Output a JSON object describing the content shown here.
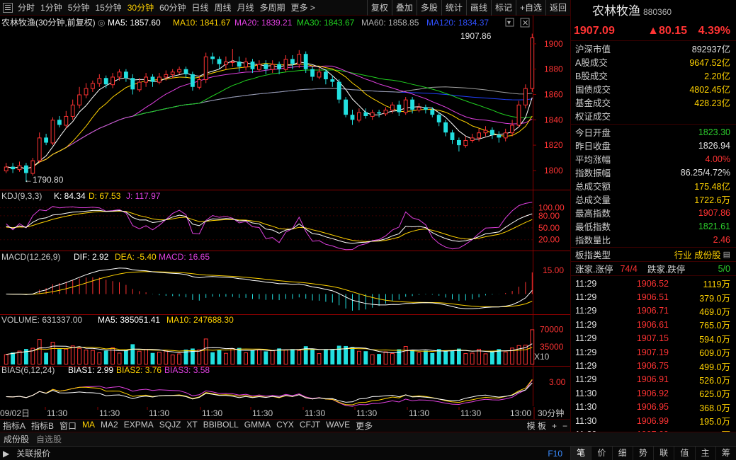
{
  "toolbar": {
    "periods": [
      "分时",
      "1分钟",
      "5分钟",
      "15分钟",
      "30分钟",
      "60分钟",
      "日线",
      "周线",
      "月线",
      "多周期",
      "更多 >"
    ],
    "active_period": "30分钟",
    "tools": [
      "复权",
      "叠加",
      "多股",
      "统计",
      "画线",
      "标记",
      "+自选",
      "返回"
    ]
  },
  "legend_main": {
    "title": "农林牧渔(30分钟,前复权)",
    "ma5": "MA5: 1857.60",
    "ma10": "MA10: 1841.67",
    "ma20": "MA20: 1839.21",
    "ma30": "MA30: 1843.67",
    "ma60": "MA60: 1858.85",
    "ma120": "MA120: 1834.37"
  },
  "legend_kdj": {
    "name": "KDJ(9,3,3)",
    "k": "K: 84.34",
    "d": "D: 67.53",
    "j": "J: 117.97"
  },
  "legend_macd": {
    "name": "MACD(12,26,9)",
    "dif": "DIF: 2.92",
    "dea": "DEA: -5.40",
    "macd": "MACD: 16.65"
  },
  "legend_vol": {
    "name": "VOLUME: 631337.00",
    "ma5": "MA5: 385051.41",
    "ma10": "MA10: 247688.30"
  },
  "legend_bias": {
    "name": "BIAS(6,12,24)",
    "b1": "BIAS1: 2.99",
    "b2": "BIAS2: 3.76",
    "b3": "BIAS3: 3.58"
  },
  "axis": {
    "price_ticks": [
      "1900",
      "1880",
      "1860",
      "1840",
      "1820",
      "1800"
    ],
    "kdj_ticks": [
      "100.00",
      "80.00",
      "50.00",
      "20.00"
    ],
    "macd_tick": "15.00",
    "vol_ticks": [
      "70000",
      "35000"
    ],
    "vol_unit": "X10",
    "bias_tick": "3.00",
    "high_label": "1907.86",
    "low_label": "←1790.80",
    "time_labels": [
      "09/02日",
      "11:30",
      "11:30",
      "11:30",
      "11:30",
      "11:30",
      "11:30",
      "11:30",
      "11:30",
      "11:30",
      "13:00"
    ],
    "period_label": "30分钟"
  },
  "indicators": [
    "指标A",
    "指标B",
    "窗口",
    "MA",
    "MA2",
    "EXPMA",
    "SQJZ",
    "XT",
    "BBIBOLL",
    "GMMA",
    "CYX",
    "CFJT",
    "WAVE",
    "更多"
  ],
  "active_indicator": "MA",
  "template_label": "模 板",
  "tabs_bottom": [
    "成份股",
    "自选股"
  ],
  "tabs_bottom2": [
    "关联报价"
  ],
  "f10": "F10",
  "side_tabs": [
    "笔",
    "价",
    "细",
    "势",
    "联",
    "值",
    "主",
    "筹"
  ],
  "panel": {
    "name": "农林牧渔",
    "code": "880360",
    "price": "1907.09",
    "change": "▲80.15",
    "pct": "4.39%",
    "stats1": [
      {
        "k": "沪深市值",
        "v": "892937亿",
        "c": "white"
      },
      {
        "k": "A股成交",
        "v": "9647.52亿",
        "c": "yellow"
      },
      {
        "k": "B股成交",
        "v": "2.20亿",
        "c": "yellow"
      },
      {
        "k": "国债成交",
        "v": "4802.45亿",
        "c": "yellow"
      },
      {
        "k": "基金成交",
        "v": "428.23亿",
        "c": "yellow"
      },
      {
        "k": "权证成交",
        "v": "",
        "c": "white"
      }
    ],
    "stats2": [
      {
        "k": "今日开盘",
        "v": "1823.30",
        "c": "green"
      },
      {
        "k": "昨日收盘",
        "v": "1826.94",
        "c": "white"
      },
      {
        "k": "平均涨幅",
        "v": "4.00%",
        "c": "red"
      },
      {
        "k": "指数振幅",
        "v": "86.25/4.72%",
        "c": "white"
      },
      {
        "k": "总成交额",
        "v": "175.48亿",
        "c": "yellow"
      },
      {
        "k": "总成交量",
        "v": "1722.6万",
        "c": "yellow"
      },
      {
        "k": "最高指数",
        "v": "1907.86",
        "c": "red"
      },
      {
        "k": "最低指数",
        "v": "1821.61",
        "c": "green"
      },
      {
        "k": "指数量比",
        "v": "2.46",
        "c": "red"
      }
    ],
    "sector": {
      "k": "板指类型",
      "v": "行业 成份股"
    },
    "updown": {
      "k1": "涨家.涨停",
      "v1": "74/4",
      "k2": "跌家.跌停",
      "v2": "5/0"
    },
    "ticks": [
      {
        "t": "11:29",
        "p": "1906.52",
        "q": "1119万"
      },
      {
        "t": "11:29",
        "p": "1906.51",
        "q": "379.0万"
      },
      {
        "t": "11:29",
        "p": "1906.71",
        "q": "469.0万"
      },
      {
        "t": "11:29",
        "p": "1906.61",
        "q": "765.0万"
      },
      {
        "t": "11:29",
        "p": "1907.15",
        "q": "594.0万"
      },
      {
        "t": "11:29",
        "p": "1907.19",
        "q": "609.0万"
      },
      {
        "t": "11:29",
        "p": "1906.75",
        "q": "499.0万"
      },
      {
        "t": "11:29",
        "p": "1906.91",
        "q": "526.0万"
      },
      {
        "t": "11:30",
        "p": "1906.92",
        "q": "625.0万"
      },
      {
        "t": "11:30",
        "p": "1906.95",
        "q": "368.0万"
      },
      {
        "t": "11:30",
        "p": "1906.99",
        "q": "195.0万"
      },
      {
        "t": "11:30",
        "p": "1907.09",
        "q": "7.00万"
      }
    ]
  },
  "colors": {
    "up": "#ff3333",
    "down": "#22e0e0",
    "ma5": "#ffffff",
    "ma10": "#ffd200",
    "ma20": "#e040e0",
    "ma30": "#20d020",
    "ma60": "#a0a0a0",
    "ma120": "#2040ff",
    "border": "#8a0000"
  },
  "chart_data": {
    "type": "candlestick",
    "price_range": [
      1786,
      1910
    ],
    "candles": [
      [
        1800,
        1803,
        1806,
        1798
      ],
      [
        1803,
        1801,
        1806,
        1798
      ],
      [
        1801,
        1804,
        1807,
        1799
      ],
      [
        1804,
        1798,
        1806,
        1791
      ],
      [
        1798,
        1808,
        1810,
        1796
      ],
      [
        1808,
        1826,
        1830,
        1806
      ],
      [
        1826,
        1822,
        1829,
        1820
      ],
      [
        1822,
        1840,
        1842,
        1820
      ],
      [
        1840,
        1836,
        1843,
        1834
      ],
      [
        1836,
        1843,
        1847,
        1833
      ],
      [
        1843,
        1852,
        1856,
        1840
      ],
      [
        1852,
        1860,
        1866,
        1849
      ],
      [
        1860,
        1865,
        1869,
        1857
      ],
      [
        1865,
        1869,
        1871,
        1862
      ],
      [
        1869,
        1873,
        1876,
        1866
      ],
      [
        1873,
        1868,
        1875,
        1865
      ],
      [
        1868,
        1874,
        1877,
        1865
      ],
      [
        1874,
        1878,
        1880,
        1871
      ],
      [
        1878,
        1873,
        1880,
        1870
      ],
      [
        1873,
        1864,
        1876,
        1860
      ],
      [
        1864,
        1870,
        1873,
        1862
      ],
      [
        1870,
        1874,
        1877,
        1866
      ],
      [
        1874,
        1870,
        1876,
        1866
      ],
      [
        1870,
        1874,
        1877,
        1868
      ],
      [
        1874,
        1876,
        1879,
        1871
      ],
      [
        1876,
        1878,
        1880,
        1873
      ],
      [
        1878,
        1880,
        1882,
        1876
      ],
      [
        1880,
        1876,
        1882,
        1873
      ],
      [
        1876,
        1866,
        1878,
        1863
      ],
      [
        1866,
        1872,
        1875,
        1864
      ],
      [
        1872,
        1890,
        1893,
        1869
      ],
      [
        1890,
        1888,
        1893,
        1884
      ],
      [
        1888,
        1884,
        1890,
        1880
      ],
      [
        1884,
        1886,
        1890,
        1880
      ],
      [
        1886,
        1886,
        1896,
        1882
      ],
      [
        1886,
        1882,
        1890,
        1878
      ],
      [
        1882,
        1886,
        1889,
        1879
      ],
      [
        1886,
        1880,
        1888,
        1877
      ],
      [
        1880,
        1884,
        1887,
        1878
      ],
      [
        1884,
        1880,
        1887,
        1876
      ],
      [
        1880,
        1884,
        1887,
        1877
      ],
      [
        1884,
        1880,
        1886,
        1876
      ],
      [
        1880,
        1888,
        1891,
        1878
      ],
      [
        1888,
        1884,
        1891,
        1880
      ],
      [
        1884,
        1892,
        1895,
        1881
      ],
      [
        1892,
        1880,
        1894,
        1877
      ],
      [
        1880,
        1874,
        1882,
        1871
      ],
      [
        1874,
        1878,
        1881,
        1872
      ],
      [
        1878,
        1872,
        1880,
        1868
      ],
      [
        1872,
        1870,
        1875,
        1866
      ],
      [
        1870,
        1856,
        1872,
        1853
      ],
      [
        1856,
        1844,
        1858,
        1842
      ],
      [
        1844,
        1840,
        1848,
        1836
      ],
      [
        1840,
        1846,
        1849,
        1838
      ],
      [
        1846,
        1843,
        1849,
        1841
      ],
      [
        1843,
        1846,
        1848,
        1840
      ],
      [
        1846,
        1845,
        1848,
        1842
      ],
      [
        1845,
        1848,
        1850,
        1843
      ],
      [
        1848,
        1852,
        1854,
        1845
      ],
      [
        1852,
        1846,
        1855,
        1843
      ],
      [
        1846,
        1856,
        1858,
        1844
      ],
      [
        1856,
        1848,
        1858,
        1845
      ],
      [
        1848,
        1850,
        1853,
        1846
      ],
      [
        1850,
        1848,
        1852,
        1845
      ],
      [
        1848,
        1844,
        1850,
        1842
      ],
      [
        1844,
        1838,
        1846,
        1835
      ],
      [
        1838,
        1830,
        1840,
        1827
      ],
      [
        1830,
        1824,
        1832,
        1821
      ],
      [
        1824,
        1820,
        1826,
        1815
      ],
      [
        1820,
        1824,
        1827,
        1818
      ],
      [
        1824,
        1826,
        1829,
        1822
      ],
      [
        1826,
        1830,
        1833,
        1823
      ],
      [
        1830,
        1832,
        1835,
        1827
      ],
      [
        1832,
        1828,
        1834,
        1825
      ],
      [
        1828,
        1826,
        1831,
        1822
      ],
      [
        1826,
        1830,
        1833,
        1823
      ],
      [
        1830,
        1836,
        1840,
        1827
      ],
      [
        1836,
        1852,
        1855,
        1834
      ],
      [
        1852,
        1865,
        1868,
        1849
      ],
      [
        1865,
        1905,
        1908,
        1862
      ]
    ]
  }
}
